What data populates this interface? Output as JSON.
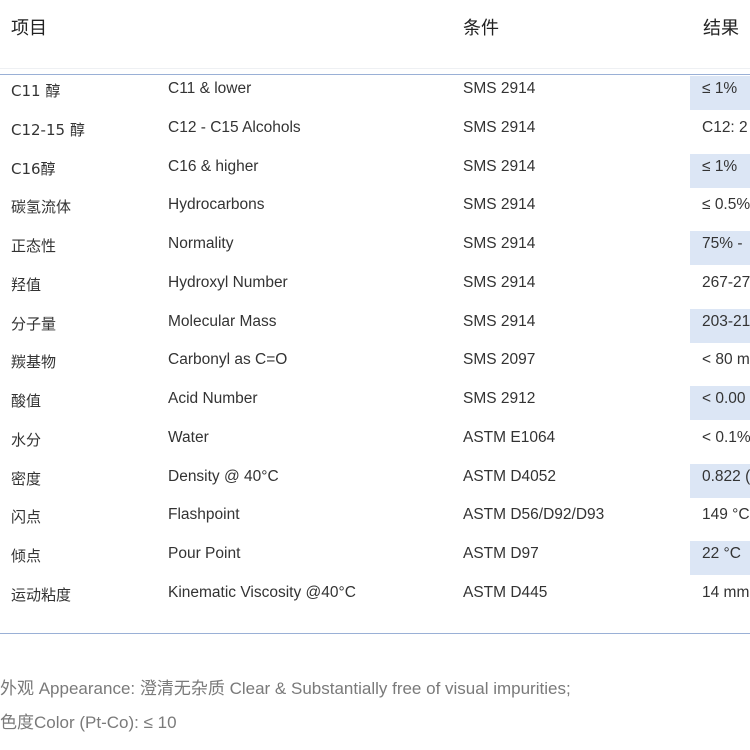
{
  "header": {
    "item": "项目",
    "condition": "条件",
    "result": "结果"
  },
  "rows": [
    {
      "zh": "C11 醇",
      "en": "C11 & lower",
      "std": "SMS 2914",
      "result": "≤ 1%",
      "shaded": true
    },
    {
      "zh": "C12-15 醇",
      "en": "C12 - C15 Alcohols",
      "std": "SMS 2914",
      "result": "C12: 2",
      "shaded": false
    },
    {
      "zh": "C16醇",
      "en": "C16 & higher",
      "std": "SMS 2914",
      "result": "≤ 1%",
      "shaded": true
    },
    {
      "zh": "碳氢流体",
      "en": "Hydrocarbons",
      "std": "SMS 2914",
      "result": "≤ 0.5%",
      "shaded": false
    },
    {
      "zh": "正态性",
      "en": "Normality",
      "std": "SMS 2914",
      "result": "75% -",
      "shaded": true
    },
    {
      "zh": "羟值",
      "en": "Hydroxyl Number",
      "std": "SMS 2914",
      "result": "267-27",
      "shaded": false
    },
    {
      "zh": "分子量",
      "en": "Molecular Mass",
      "std": "SMS 2914",
      "result": "203-21",
      "shaded": true
    },
    {
      "zh": "羰基物",
      "en": "Carbonyl as C=O",
      "std": "SMS 2097",
      "result": "< 80 m",
      "shaded": false
    },
    {
      "zh": "酸值",
      "en": "Acid Number",
      "std": "SMS 2912",
      "result": "< 0.00",
      "shaded": true
    },
    {
      "zh": "水分",
      "en": "Water",
      "std": "ASTM E1064",
      "result": "< 0.1%",
      "shaded": false
    },
    {
      "zh": "密度",
      "en": "Density @ 40°C",
      "std": "ASTM D4052",
      "result": "0.822 (",
      "shaded": true
    },
    {
      "zh": "闪点",
      "en": "Flashpoint",
      "std": "ASTM D56/D92/D93",
      "result": "149 °C",
      "shaded": false
    },
    {
      "zh": "倾点",
      "en": "Pour Point",
      "std": "ASTM D97",
      "result": "22 °C",
      "shaded": true
    },
    {
      "zh": "运动粘度",
      "en": "Kinematic Viscosity @40°C",
      "std": "ASTM D445",
      "result": "14 mm",
      "shaded": false
    }
  ],
  "notes": {
    "appearance": "外观 Appearance: 澄清无杂质 Clear & Substantially free of visual impurities;",
    "color": "色度Color (Pt-Co): ≤ 10"
  }
}
